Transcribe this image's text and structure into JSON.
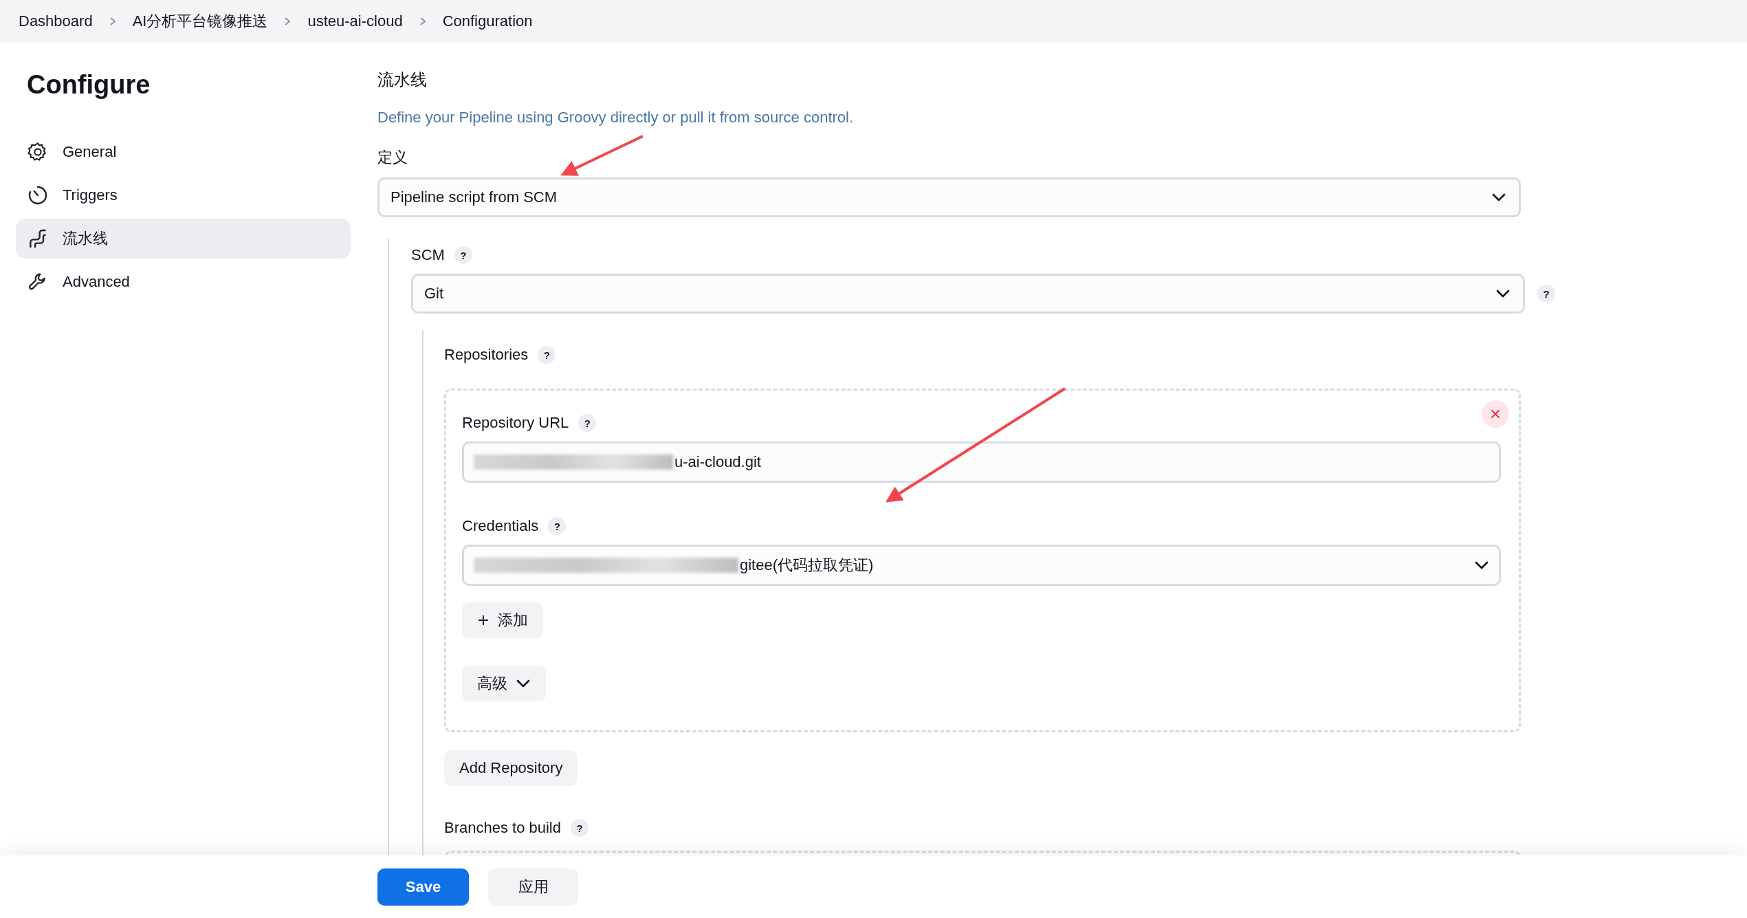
{
  "breadcrumbs": [
    "Dashboard",
    "AI分析平台镜像推送",
    "usteu-ai-cloud",
    "Configuration"
  ],
  "sidebar": {
    "title": "Configure",
    "items": [
      {
        "label": "General",
        "selected": false
      },
      {
        "label": "Triggers",
        "selected": false
      },
      {
        "label": "流水线",
        "selected": true
      },
      {
        "label": "Advanced",
        "selected": false
      }
    ]
  },
  "section": {
    "title": "流水线",
    "description": "Define your Pipeline using Groovy directly or pull it from source control.",
    "definition": {
      "label": "定义",
      "value": "Pipeline script from SCM"
    },
    "scm": {
      "label": "SCM",
      "help": "?",
      "value": "Git",
      "side_help": "?",
      "repositories": {
        "label": "Repositories",
        "help": "?",
        "items": [
          {
            "url_label": "Repository URL",
            "url_help": "?",
            "url_value": "u-ai-cloud.git",
            "credentials_label": "Credentials",
            "credentials_help": "?",
            "credentials_value": "gitee(代码拉取凭证)",
            "add_button": "添加",
            "advanced_button": "高级"
          }
        ]
      },
      "add_repository": "Add Repository",
      "branches_label": "Branches to build",
      "branches_help": "?"
    }
  },
  "footer": {
    "buttons": [
      {
        "label": "Save",
        "kind": "primary"
      },
      {
        "label": "应用",
        "kind": "secondary"
      }
    ]
  }
}
